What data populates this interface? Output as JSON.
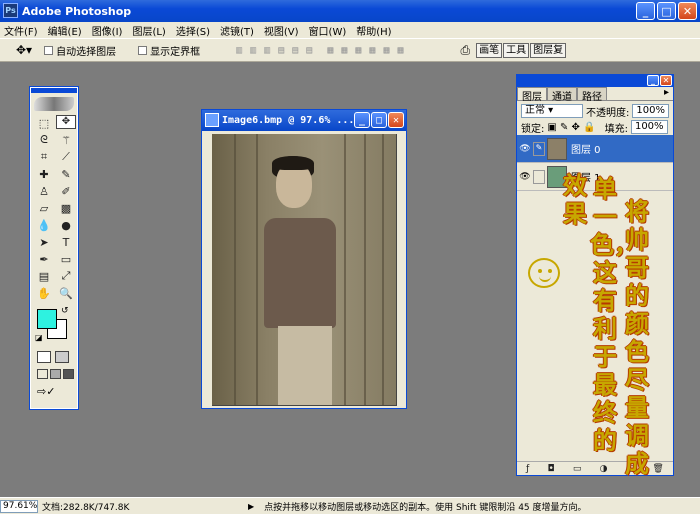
{
  "app": {
    "title": "Adobe Photoshop"
  },
  "menu": [
    "文件(F)",
    "编辑(E)",
    "图像(I)",
    "图层(L)",
    "选择(S)",
    "滤镜(T)",
    "视图(V)",
    "窗口(W)",
    "帮助(H)"
  ],
  "options": {
    "auto_select": "自动选择图层",
    "show_bounds": "显示定界框",
    "right_tabs": [
      "画笔",
      "工具",
      "图层复"
    ]
  },
  "document": {
    "title": "Image6.bmp @ 97.6% ..."
  },
  "layers_panel": {
    "tabs": [
      "图层",
      "通道",
      "路径"
    ],
    "blend_mode": "正常",
    "opacity_label": "不透明度:",
    "opacity": "100%",
    "lock_label": "锁定:",
    "fill_label": "填充:",
    "fill": "100%",
    "layers": [
      {
        "name": "图层 0"
      },
      {
        "name": "图层 1"
      }
    ]
  },
  "overlay_text": {
    "col1": "将帅哥的颜色尽量调成",
    "col2": "单一色，这有利于最终的",
    "col3": "效果"
  },
  "statusbar": {
    "zoom": "97.61%",
    "doc_info": "文档:282.8K/747.8K",
    "hint": "点按并拖移以移动图层或移动选区的副本。使用 Shift 键限制沿 45 度增量方向。"
  },
  "colors": {
    "foreground": "#2ef2e0",
    "background": "#ffffff",
    "accent": "#0a49d6",
    "overlay_text": "#c7a700"
  }
}
